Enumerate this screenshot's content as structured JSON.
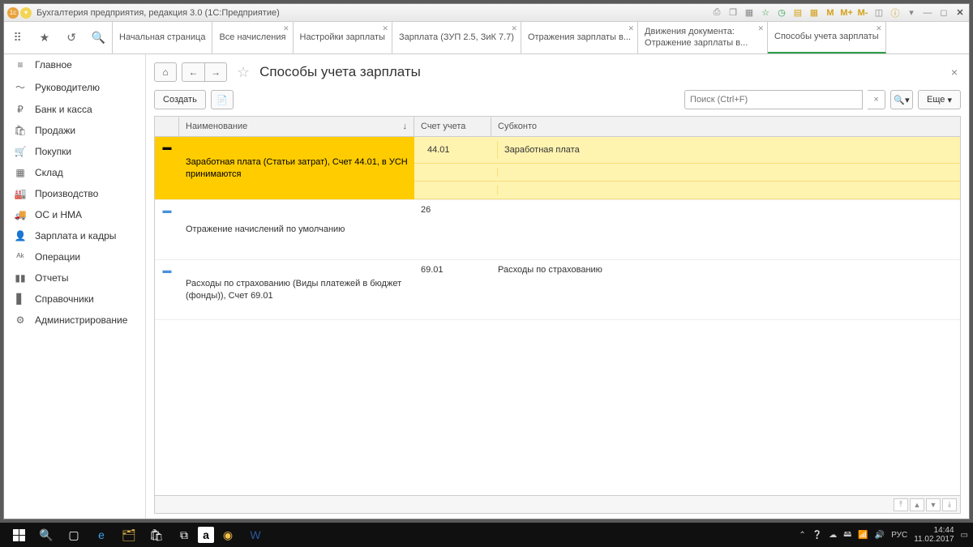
{
  "titlebar": {
    "title": "Бухгалтерия предприятия, редакция 3.0  (1С:Предприятие)"
  },
  "tabs": [
    {
      "label": "Начальная страница",
      "closable": false
    },
    {
      "label": "Все начисления",
      "closable": true
    },
    {
      "label": "Настройки зарплаты",
      "closable": true
    },
    {
      "label": "Зарплата (ЗУП 2.5, ЗиК 7.7)",
      "closable": true
    },
    {
      "label": "Отражения зарплаты в...",
      "closable": true
    },
    {
      "label": "Движения документа: Отражение зарплаты в...",
      "closable": true
    },
    {
      "label": "Способы учета зарплаты",
      "closable": true,
      "active": true
    }
  ],
  "sidebar": {
    "items": [
      {
        "icon": "≡",
        "label": "Главное"
      },
      {
        "icon": "〜",
        "label": "Руководителю"
      },
      {
        "icon": "₽",
        "label": "Банк и касса"
      },
      {
        "icon": "🛍",
        "label": "Продажи"
      },
      {
        "icon": "🛒",
        "label": "Покупки"
      },
      {
        "icon": "▦",
        "label": "Склад"
      },
      {
        "icon": "🏭",
        "label": "Производство"
      },
      {
        "icon": "🚚",
        "label": "ОС и НМА"
      },
      {
        "icon": "👤",
        "label": "Зарплата и кадры"
      },
      {
        "icon": "ᴬᵏ",
        "label": "Операции"
      },
      {
        "icon": "▮▮",
        "label": "Отчеты"
      },
      {
        "icon": "▋",
        "label": "Справочники"
      },
      {
        "icon": "⚙",
        "label": "Администрирование"
      }
    ]
  },
  "page": {
    "title": "Способы учета зарплаты",
    "create": "Создать",
    "more": "Еще",
    "search_placeholder": "Поиск (Ctrl+F)"
  },
  "table": {
    "headers": {
      "name": "Наименование",
      "account": "Счет учета",
      "subconto": "Субконто"
    },
    "rows": [
      {
        "name": "Заработная плата (Статьи затрат), Счет 44.01, в УСН принимаются",
        "account": "44.01",
        "subconto": "Заработная плата",
        "selected": true
      },
      {
        "name": "Отражение начислений по умолчанию",
        "account": "26",
        "subconto": ""
      },
      {
        "name": "Расходы по страхованию (Виды платежей в бюджет (фонды)), Счет 69.01",
        "account": "69.01",
        "subconto": "Расходы по страхованию"
      }
    ]
  },
  "taskbar": {
    "lang": "РУС",
    "time": "14:44",
    "date": "11.02.2017"
  }
}
